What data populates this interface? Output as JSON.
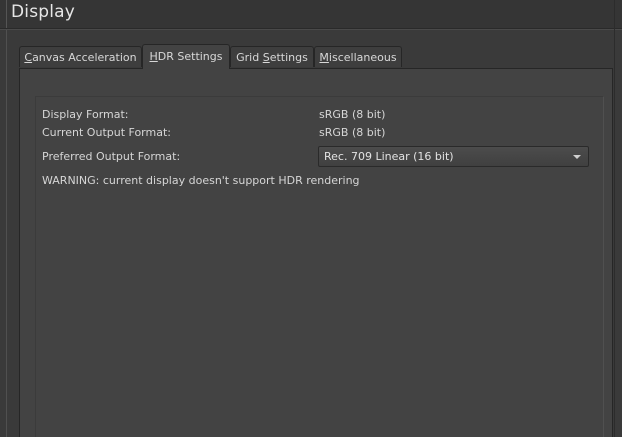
{
  "window": {
    "title": "Display"
  },
  "tabs": [
    {
      "label_before": "",
      "mnemonic": "C",
      "label_after": "anvas Acceleration",
      "active": false
    },
    {
      "label_before": "",
      "mnemonic": "H",
      "label_after": "DR Settings",
      "active": true
    },
    {
      "label_before": "Grid ",
      "mnemonic": "S",
      "label_after": "ettings",
      "active": false
    },
    {
      "label_before": "",
      "mnemonic": "M",
      "label_after": "iscellaneous",
      "active": false
    }
  ],
  "hdr": {
    "display_format_label": "Display Format:",
    "display_format_value": "sRGB (8 bit)",
    "current_output_label": "Current Output Format:",
    "current_output_value": "sRGB (8 bit)",
    "preferred_output_label": "Preferred Output Format:",
    "preferred_output_value": "Rec. 709 Linear (16 bit)",
    "warning": "WARNING: current display doesn't support HDR rendering"
  },
  "icons": {
    "combo_arrow": "chevron-down-icon"
  }
}
